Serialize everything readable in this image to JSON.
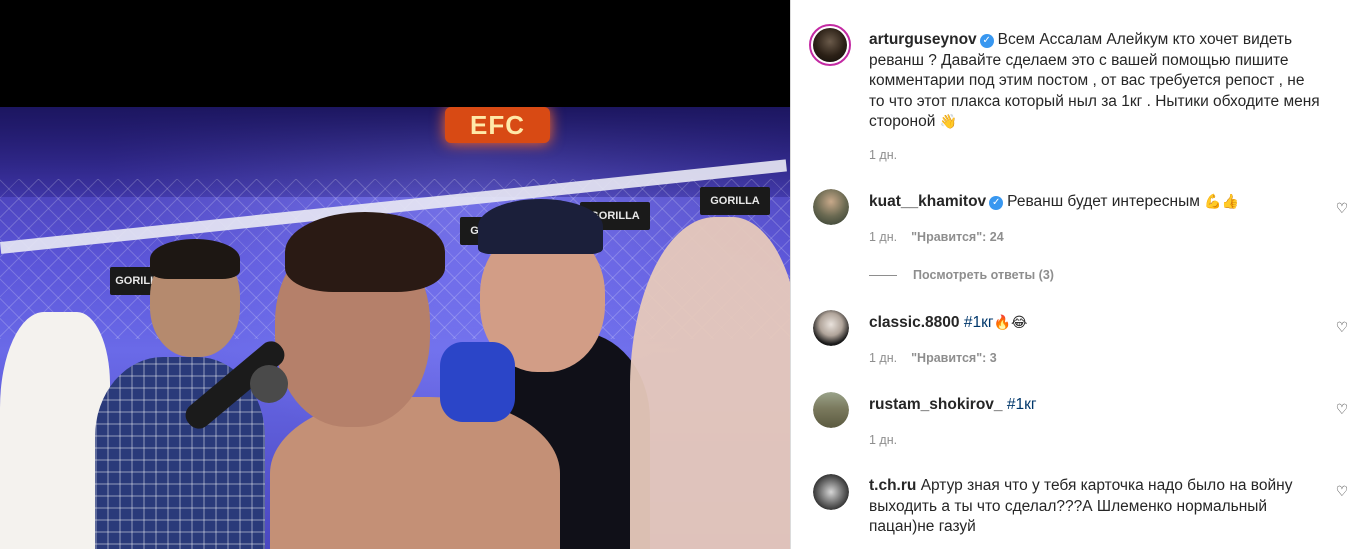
{
  "post": {
    "author": "arturguseynov",
    "caption": "Всем Ассалам Алейкум кто хочет видеть реванш ? Давайте сделаем это с вашей помощью пишите комментарии под этим постом , от вас требуется репост , не то что этот плакса который ныл за 1кг . Нытики обходите меня стороной",
    "caption_emoji": "👋",
    "time": "1 дн."
  },
  "video": {
    "sign_text": "EFC",
    "banner_text": "GORILLA"
  },
  "comments": [
    {
      "user": "kuat__khamitov",
      "verified": true,
      "text": "Реванш будет интересным",
      "emoji": "💪👍",
      "time": "1 дн.",
      "likes": "\"Нравится\": 24",
      "replies": "Посмотреть ответы (3)"
    },
    {
      "user": "classic.8800",
      "verified": false,
      "tag": "#1кг",
      "emoji": "🔥😂",
      "time": "1 дн.",
      "likes": "\"Нравится\": 3"
    },
    {
      "user": "rustam_shokirov_",
      "verified": false,
      "tag": "#1кг",
      "time": "1 дн."
    },
    {
      "user": "t.ch.ru",
      "verified": false,
      "text": "Артур зная что у тебя карточка надо было на войну выходить а ты что сделал???А Шлеменко нормальный пацан)не газуй"
    }
  ],
  "icons": {
    "verified": "verified-badge-icon",
    "like": "heart-outline-icon"
  },
  "colors": {
    "verified": "#3897f0",
    "meta": "#8e8e8e",
    "link": "#00376b",
    "story_ring": "#c32aa3"
  }
}
